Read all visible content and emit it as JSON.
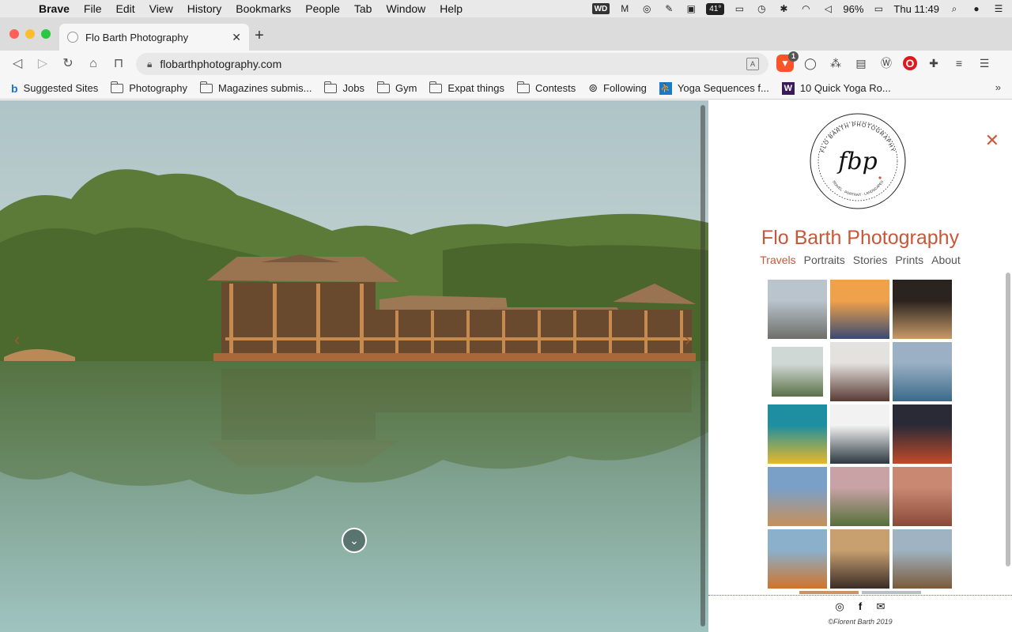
{
  "menubar": {
    "app": "Brave",
    "items": [
      "File",
      "Edit",
      "View",
      "History",
      "Bookmarks",
      "People",
      "Tab",
      "Window",
      "Help"
    ],
    "tray": {
      "wd_label": "WD",
      "temperature": "41°",
      "battery": "96%",
      "clock": "Thu 11:49"
    }
  },
  "tab": {
    "title": "Flo Barth Photography",
    "close": "✕",
    "new_tab": "+"
  },
  "toolbar": {
    "url": "flobarthphotography.com",
    "brave_badge": "1"
  },
  "bookmarks": [
    {
      "label": "Suggested Sites",
      "icon": "bing-icon"
    },
    {
      "label": "Photography",
      "icon": "folder-icon"
    },
    {
      "label": "Magazines submis...",
      "icon": "folder-icon"
    },
    {
      "label": "Jobs",
      "icon": "folder-icon"
    },
    {
      "label": "Gym",
      "icon": "folder-icon"
    },
    {
      "label": "Expat things",
      "icon": "folder-icon"
    },
    {
      "label": "Contests",
      "icon": "folder-icon"
    },
    {
      "label": "Following",
      "icon": "following-icon"
    },
    {
      "label": "Yoga Sequences f...",
      "icon": "yoga-icon"
    },
    {
      "label": "10 Quick Yoga Ro...",
      "icon": "w-icon"
    }
  ],
  "sidebar": {
    "title": "Flo Barth Photography",
    "close": "✕",
    "logo_top_text": "FLO BARTH PHOTOGRAPHY",
    "logo_bottom_text": "TRAVEL · PORTRAIT · LANDSCAPES",
    "logo_initials": "fbp",
    "nav": [
      {
        "label": "Travels",
        "active": true
      },
      {
        "label": "Portraits",
        "active": false
      },
      {
        "label": "Stories",
        "active": false
      },
      {
        "label": "Prints",
        "active": false
      },
      {
        "label": "About",
        "active": false
      }
    ],
    "thumbnails": [
      {
        "name": "cathedral",
        "colors": [
          "#b9c4cc",
          "#6f6f6a"
        ]
      },
      {
        "name": "mountain-sunset",
        "colors": [
          "#f0a24a",
          "#3a4a72"
        ]
      },
      {
        "name": "night-square",
        "colors": [
          "#2a2320",
          "#c89a68"
        ]
      },
      {
        "name": "lake-pavilion",
        "colors": [
          "#cfd8d4",
          "#5b7048"
        ]
      },
      {
        "name": "horse-statue",
        "colors": [
          "#e4e2de",
          "#5a3a34"
        ]
      },
      {
        "name": "colorful-domes",
        "colors": [
          "#9bb0c4",
          "#3a6a8a"
        ]
      },
      {
        "name": "turquoise-facade",
        "colors": [
          "#1d8fa0",
          "#e8b72a"
        ]
      },
      {
        "name": "street-clock",
        "colors": [
          "#f2f2f2",
          "#2b3840"
        ]
      },
      {
        "name": "cafe-interior",
        "colors": [
          "#2a2a36",
          "#c24a2a"
        ]
      },
      {
        "name": "acropolis",
        "colors": [
          "#7aa0c8",
          "#c8905a"
        ]
      },
      {
        "name": "pink-tower",
        "colors": [
          "#c9a2a6",
          "#55703a"
        ]
      },
      {
        "name": "red-rooftops",
        "colors": [
          "#c98872",
          "#8a4a38"
        ]
      },
      {
        "name": "orange-dunes",
        "colors": [
          "#8ab0cc",
          "#d0742a"
        ]
      },
      {
        "name": "underground-station",
        "colors": [
          "#c8a070",
          "#3a2c28"
        ]
      },
      {
        "name": "city-bridge",
        "colors": [
          "#9fb3c2",
          "#7a5a3a"
        ]
      }
    ],
    "footer": {
      "copyright": "©Florent Barth 2019"
    }
  },
  "hero": {
    "prev": "‹",
    "next": "›",
    "scroll_down": "⌄"
  },
  "colors": {
    "accent": "#c5583a",
    "sky": "#b9ccd0",
    "water": "#6fa3a0",
    "foliage": "#4a6b2a",
    "wood": "#a8683a"
  }
}
